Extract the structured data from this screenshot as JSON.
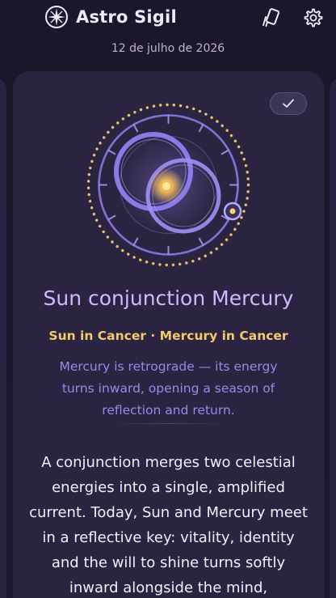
{
  "app": {
    "name": "Astro Sigil",
    "logo_icon": "compass-star-icon"
  },
  "header": {
    "actions": [
      {
        "id": "cards",
        "icon": "cards-icon"
      },
      {
        "id": "settings",
        "icon": "gear-icon"
      }
    ]
  },
  "date": "12 de julho de 2026",
  "card": {
    "title": "Sun conjunction Mercury",
    "placements": "Sun in Cancer · Mercury in Cancer",
    "note": "Mercury is retrograde — its energy turns inward, opening a season of reflection and return.",
    "body": "A conjunction merges two celestial energies into a single, amplified current. Today, Sun and Mercury meet in a reflective key: vitality, identity and the will to shine turns softly inward alongside the mind,",
    "check_icon": "checkmark-icon"
  },
  "colors": {
    "background": "#1b1629",
    "card": "#2b2441",
    "title": "#cfb9ff",
    "gold": "#f4c96a",
    "note": "#9a87e6",
    "ring": "#8c7ae6"
  }
}
